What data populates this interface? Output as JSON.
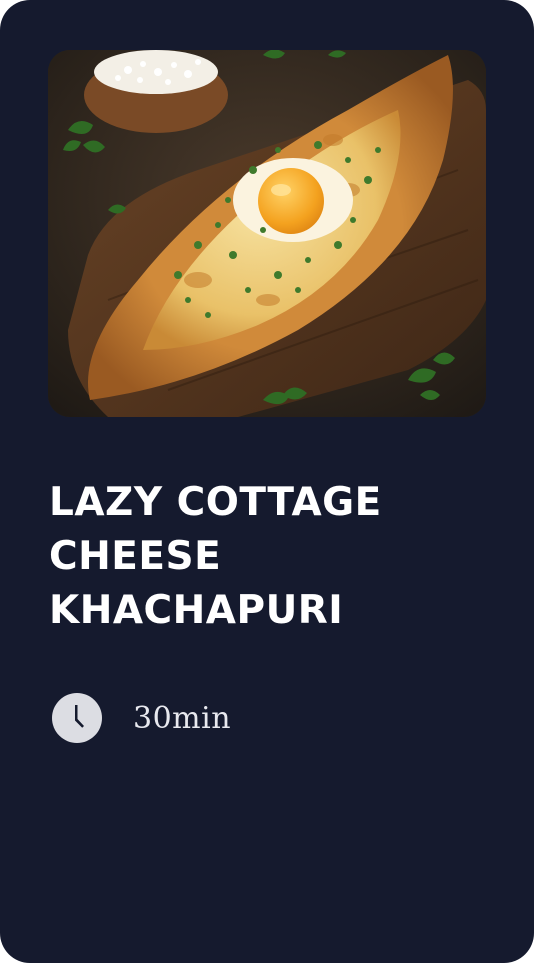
{
  "recipe": {
    "title": "LAZY COTTAGE CHEESE KHACHAPURI",
    "cook_time": "30min",
    "time_icon": "clock-icon",
    "image_subject": "khachapuri-photo"
  },
  "colors": {
    "card_background": "#151a2e",
    "title_text": "#ffffff",
    "time_text": "#e8e9ef",
    "icon_fill": "#dcdde3"
  }
}
